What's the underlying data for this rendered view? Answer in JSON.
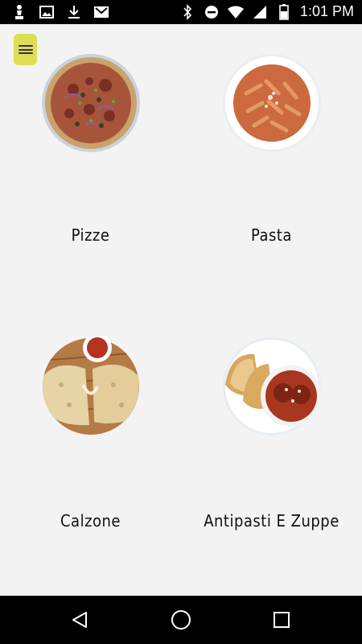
{
  "status_bar": {
    "time": "1:01 PM",
    "left_icons": [
      "chess-icon",
      "image-icon",
      "download-icon",
      "mail-icon"
    ],
    "right_icons": [
      "bluetooth-icon",
      "do-not-disturb-icon",
      "wifi-icon",
      "signal-icon",
      "battery-icon"
    ]
  },
  "menu": {
    "icon": "hamburger-menu-icon",
    "color": "#dede55"
  },
  "categories": [
    {
      "label": "Pizze"
    },
    {
      "label": "Pasta"
    },
    {
      "label": "Calzone"
    },
    {
      "label": "Antipasti E Zuppe"
    }
  ],
  "navigation_bar": {
    "buttons": [
      "back-icon",
      "home-icon",
      "recents-icon"
    ]
  }
}
